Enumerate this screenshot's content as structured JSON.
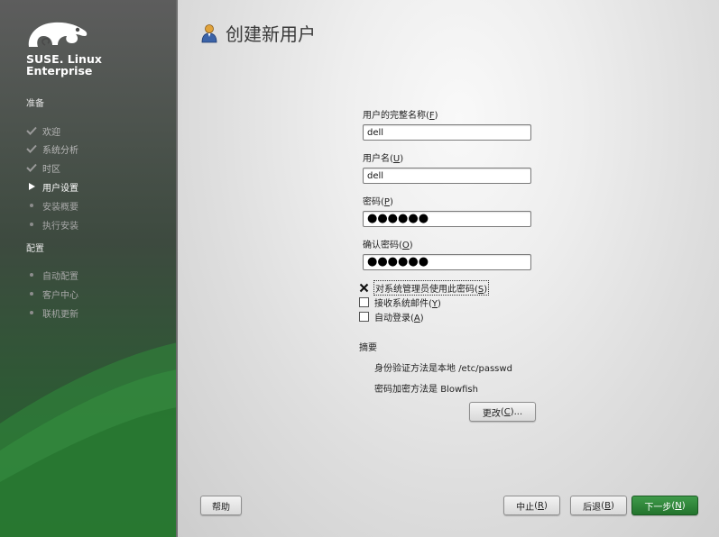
{
  "sidebar": {
    "brand_line1": "SUSE. Linux",
    "brand_line2": "Enterprise",
    "sections": [
      {
        "title": "准备",
        "items": [
          {
            "label": "欢迎",
            "state": "done"
          },
          {
            "label": "系统分析",
            "state": "done"
          },
          {
            "label": "时区",
            "state": "done"
          },
          {
            "label": "用户设置",
            "state": "current"
          },
          {
            "label": "安装概要",
            "state": "pending"
          },
          {
            "label": "执行安装",
            "state": "pending"
          }
        ]
      },
      {
        "title": "配置",
        "items": [
          {
            "label": "自动配置",
            "state": "pending"
          },
          {
            "label": "客户中心",
            "state": "pending"
          },
          {
            "label": "联机更新",
            "state": "pending"
          }
        ]
      }
    ]
  },
  "main": {
    "title": "创建新用户",
    "title_icon": "user-icon",
    "fields": {
      "full_name": {
        "label": "用户的完整名称",
        "key": "F",
        "value": "dell"
      },
      "username": {
        "label": "用户名",
        "key": "U",
        "value": "dell"
      },
      "password": {
        "label": "密码",
        "key": "P",
        "value": "●●●●●●"
      },
      "confirm": {
        "label": "确认密码",
        "key": "O",
        "value": "●●●●●●"
      }
    },
    "checkboxes": {
      "admin_pw": {
        "label": "对系统管理员使用此密码",
        "key": "S",
        "checked": true
      },
      "receive_mail": {
        "label": "接收系统邮件",
        "key": "Y",
        "checked": false
      },
      "autologin": {
        "label": "自动登录",
        "key": "A",
        "checked": false
      }
    },
    "summary": {
      "title": "摘要",
      "auth_prefix": "身份验证方法是本地 ",
      "auth_value": "/etc/passwd",
      "enc_prefix": "密码加密方法是 ",
      "enc_value": "Blowfish"
    },
    "change_button": {
      "label": "更改",
      "key": "C",
      "suffix": "..."
    }
  },
  "footer": {
    "help": "帮助",
    "abort": {
      "label": "中止",
      "key": "R"
    },
    "back": {
      "label": "后退",
      "key": "B"
    },
    "next": {
      "label": "下一步",
      "key": "N"
    }
  },
  "colors": {
    "accent_green": "#2a7a33",
    "sidebar_bg": "#4a4a4a"
  }
}
